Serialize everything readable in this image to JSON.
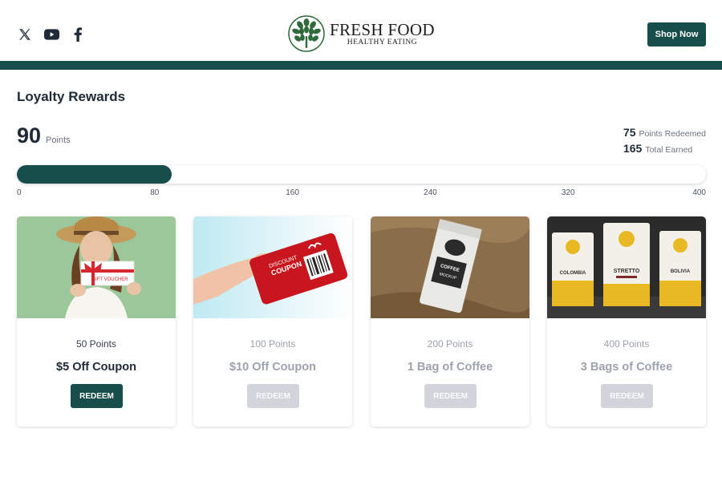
{
  "header": {
    "social_icons": [
      "x-twitter-icon",
      "youtube-icon",
      "facebook-icon"
    ],
    "logo_title": "FRESH FOOD",
    "logo_subtitle": "HEALTHY EATING",
    "shop_button": "Shop Now"
  },
  "loyalty": {
    "title": "Loyalty Rewards",
    "points": "90",
    "points_label": "Points",
    "redeemed_value": "75",
    "redeemed_label": "Points Redeemed",
    "earned_value": "165",
    "earned_label": "Total Earned",
    "progress_fraction": 0.225,
    "scale_ticks": [
      "0",
      "80",
      "160",
      "240",
      "320",
      "400"
    ]
  },
  "rewards": [
    {
      "points": "50 Points",
      "title": "$5 Off Coupon",
      "button": "REDEEM",
      "available": true,
      "image": "woman-holding-gift-voucher"
    },
    {
      "points": "100 Points",
      "title": "$10 Off Coupon",
      "button": "REDEEM",
      "available": false,
      "image": "hand-holding-discount-coupon-card"
    },
    {
      "points": "200 Points",
      "title": "1 Bag of Coffee",
      "button": "REDEEM",
      "available": false,
      "image": "coffee-bag-on-burlap"
    },
    {
      "points": "400 Points",
      "title": "3 Bags of Coffee",
      "button": "REDEEM",
      "available": false,
      "image": "three-coffee-bags"
    }
  ],
  "image_text": {
    "voucher": "GIFT VOUCHER",
    "coupon_line1": "DISCOUNT",
    "coupon_line2": "COUPON",
    "coffee_bag_line1": "COFFEE",
    "coffee_bag_line2": "MOCKUP",
    "bag1": "COLOMBIA",
    "bag2": "STRETTO",
    "bag3": "BOLIVIA"
  },
  "colors": {
    "brand": "#174d4a",
    "disabled_button": "#d1d5db",
    "muted_text": "#9ca3af"
  }
}
